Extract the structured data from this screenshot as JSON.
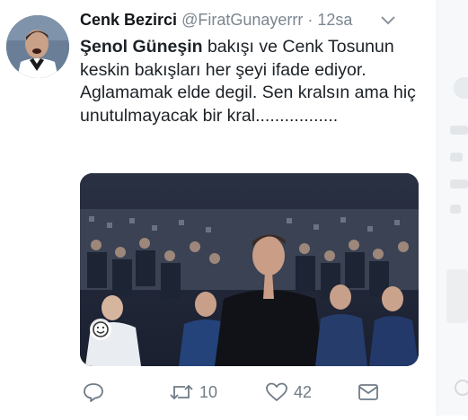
{
  "tweet": {
    "display_name": "Cenk Bezirci",
    "handle": "@FiratGunayerrr",
    "separator": "·",
    "time": "12sa",
    "text_bold": "Şenol Güneşin",
    "text_rest": " bakışı ve Cenk Tosunun keskin bakışları her şeyi ifade ediyor. Aglamamak elde degil. Sen kralsın ama hiç unutulmayacak bir kral.................",
    "avatar_icon": "profile-photo",
    "menu_icon": "chevron-down-icon"
  },
  "media": {
    "type": "photo",
    "badge_icon": "smiley-icon"
  },
  "actions": {
    "reply_icon": "reply-icon",
    "retweet_icon": "retweet-icon",
    "retweet_count": "10",
    "like_icon": "heart-icon",
    "like_count": "42",
    "dm_icon": "envelope-icon"
  },
  "colors": {
    "text": "#14171a",
    "muted": "#7b8690",
    "icon": "#6f7b86",
    "background": "#ffffff"
  }
}
